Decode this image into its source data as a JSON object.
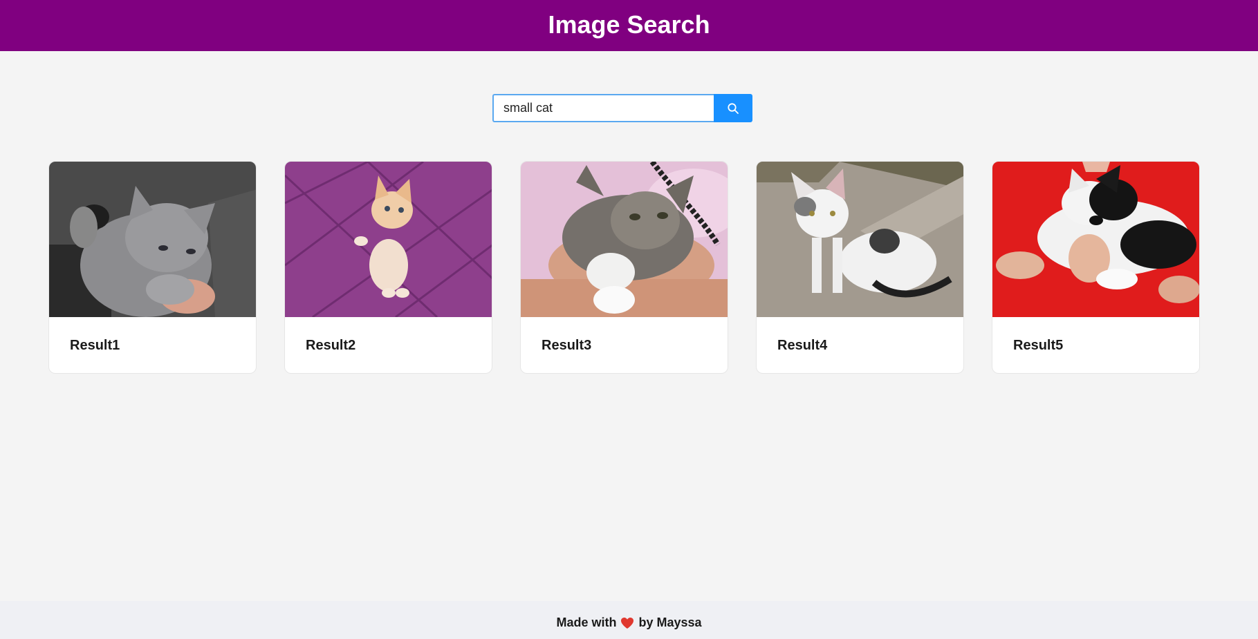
{
  "header": {
    "title": "Image Search",
    "color": "#800080"
  },
  "search": {
    "value": "small cat",
    "button_icon": "search-icon",
    "button_color": "#1890ff"
  },
  "results": [
    {
      "title": "Result1"
    },
    {
      "title": "Result2"
    },
    {
      "title": "Result3"
    },
    {
      "title": "Result4"
    },
    {
      "title": "Result5"
    }
  ],
  "footer": {
    "prefix": "Made with",
    "icon": "heart-icon",
    "suffix": "by Mayssa"
  }
}
